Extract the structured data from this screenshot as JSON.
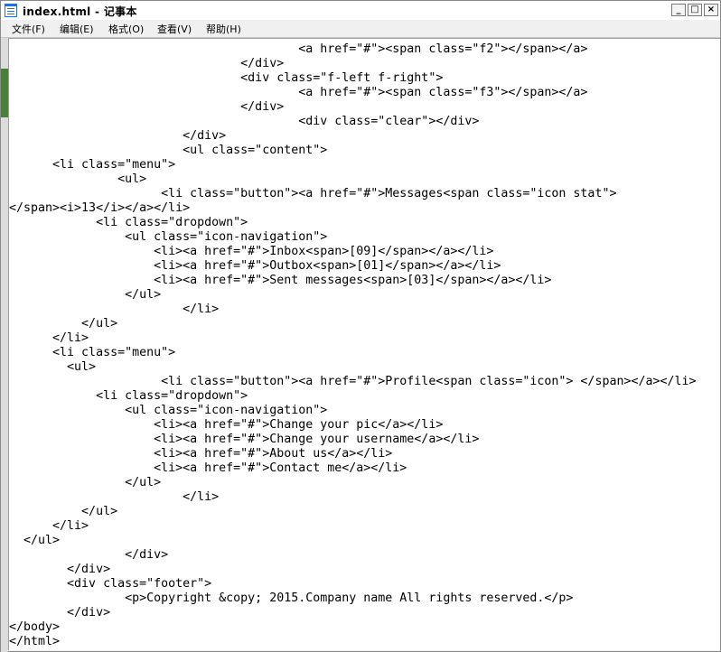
{
  "window": {
    "title": "index.html - 记事本",
    "controls": {
      "minimize": "_",
      "maximize": "□",
      "close": "×"
    }
  },
  "menu": {
    "file": "文件(F)",
    "edit": "编辑(E)",
    "format": "格式(O)",
    "view": "查看(V)",
    "help": "帮助(H)"
  },
  "editor": {
    "lines": [
      "                                        <a href=\"#\"><span class=\"f2\"></span></a>",
      "                                </div>",
      "                                <div class=\"f-left f-right\">",
      "                                        <a href=\"#\"><span class=\"f3\"></span></a>",
      "                                </div>",
      "                                        <div class=\"clear\"></div>",
      "                        </div>",
      "                        <ul class=\"content\">",
      "      <li class=\"menu\">",
      "               <ul>",
      "                     <li class=\"button\"><a href=\"#\">Messages<span class=\"icon stat\">",
      "</span><i>13</i></a></li>",
      "            <li class=\"dropdown\">",
      "                <ul class=\"icon-navigation\">",
      "                    <li><a href=\"#\">Inbox<span>[09]</span></a></li>",
      "                    <li><a href=\"#\">Outbox<span>[01]</span></a></li>",
      "                    <li><a href=\"#\">Sent messages<span>[03]</span></a></li>",
      "                </ul>",
      "                        </li>",
      "          </ul>",
      "      </li>",
      "      <li class=\"menu\">",
      "        <ul>",
      "                     <li class=\"button\"><a href=\"#\">Profile<span class=\"icon\"> </span></a></li>",
      "            <li class=\"dropdown\">",
      "                <ul class=\"icon-navigation\">",
      "                    <li><a href=\"#\">Change your pic</a></li>",
      "                    <li><a href=\"#\">Change your username</a></li>",
      "                    <li><a href=\"#\">About us</a></li>",
      "                    <li><a href=\"#\">Contact me</a></li>",
      "                </ul>",
      "                        </li>",
      "          </ul>",
      "      </li>",
      "  </ul>",
      "                </div>",
      "        </div>",
      "        <div class=\"footer\">",
      "                <p>Copyright &copy; 2015.Company name All rights reserved.</p>",
      "        </div>",
      "</body>",
      "</html>"
    ]
  }
}
